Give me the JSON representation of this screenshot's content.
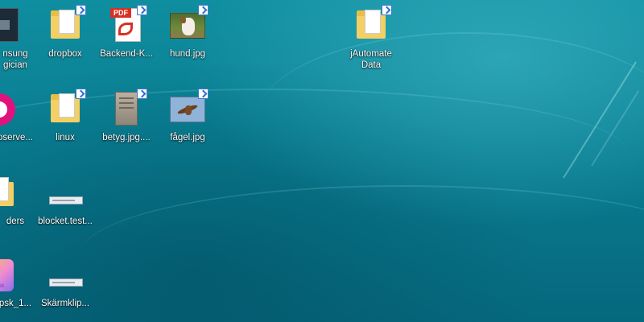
{
  "desktop": {
    "icons": [
      {
        "line1": "nsung",
        "line2": "gician",
        "kind": "dark-app-icon"
      },
      {
        "line1": "dropbox",
        "line2": "",
        "kind": "folder-icon"
      },
      {
        "line1": "Backend-K...",
        "line2": "",
        "kind": "pdf-icon",
        "badge": "PDF"
      },
      {
        "line1": "hund.jpg",
        "line2": "",
        "kind": "image-icon"
      },
      {
        "line1": "jAutomate",
        "line2": "Data",
        "kind": "folder-icon"
      },
      {
        "line1": "oserve...",
        "line2": "",
        "kind": "magenta-app-icon"
      },
      {
        "line1": "linux",
        "line2": "",
        "kind": "folder-icon"
      },
      {
        "line1": "betyg.jpg....",
        "line2": "",
        "kind": "image-icon"
      },
      {
        "line1": "fågel.jpg",
        "line2": "",
        "kind": "image-icon"
      },
      {
        "line1": "ders",
        "line2": "",
        "kind": "folder-icon"
      },
      {
        "line1": "blocket.test...",
        "line2": "",
        "kind": "screenshot-icon"
      },
      {
        "line1": "psk_1...",
        "line2": "",
        "kind": "colorful-image-icon",
        "badge": "D PÅSK"
      },
      {
        "line1": "Skärmklip...",
        "line2": "",
        "kind": "screenshot-icon"
      }
    ]
  },
  "colors": {
    "background_top": "#0f8ea0",
    "background_bottom": "#06687d",
    "folder": "#f4cf63",
    "pdf_red": "#d93025",
    "magenta": "#e0137c"
  }
}
